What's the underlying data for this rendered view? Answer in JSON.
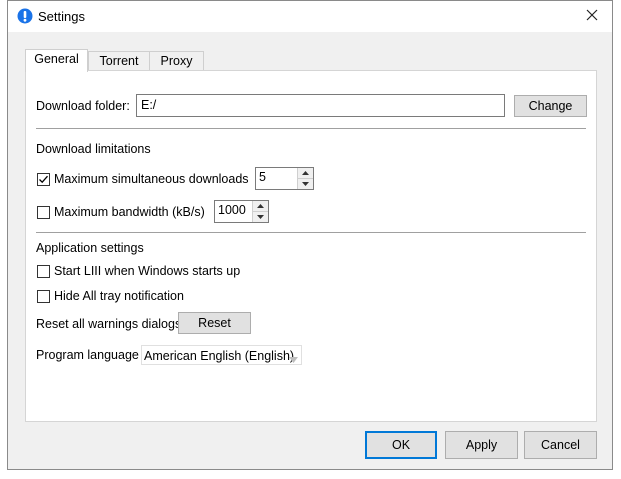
{
  "window": {
    "title": "Settings",
    "icon": "app-info-icon"
  },
  "tabs": [
    {
      "label": "General",
      "active": true
    },
    {
      "label": "Torrent",
      "active": false
    },
    {
      "label": "Proxy",
      "active": false
    }
  ],
  "download_folder": {
    "label": "Download folder:",
    "value": "E:/",
    "change_label": "Change"
  },
  "download_limitations": {
    "heading": "Download limitations",
    "max_downloads": {
      "label": "Maximum simultaneous downloads",
      "checked": true,
      "value": "5"
    },
    "max_bandwidth": {
      "label": "Maximum bandwidth (kB/s)",
      "checked": false,
      "value": "1000"
    }
  },
  "application_settings": {
    "heading": "Application settings",
    "start_with_windows": {
      "label": "Start LIII when Windows starts up",
      "checked": false
    },
    "hide_tray": {
      "label": "Hide All tray notification",
      "checked": false
    },
    "reset_warnings": {
      "label": "Reset all warnings dialogs",
      "button_label": "Reset"
    },
    "language": {
      "label": "Program language",
      "value": "American English (English)"
    }
  },
  "footer": {
    "ok_label": "OK",
    "apply_label": "Apply",
    "cancel_label": "Cancel"
  },
  "colors": {
    "accent": "#0078d7",
    "info_icon": "#1a73e8"
  }
}
